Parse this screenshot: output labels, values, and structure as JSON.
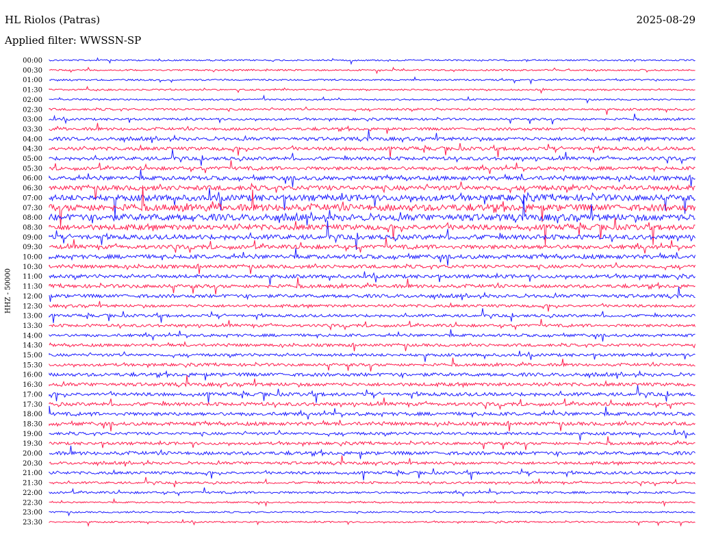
{
  "header": {
    "station": "HL Riolos (Patras)",
    "date": "2025-08-29",
    "filter": "Applied filter: WWSSN-SP"
  },
  "colors": {
    "even": "#1a1aff",
    "odd": "#ff1a4b",
    "text": "#000000",
    "background": "#ffffff"
  },
  "chart_data": {
    "type": "helicorder",
    "ylabel": "HHZ - 50000",
    "trace_colors": [
      "blue",
      "red"
    ],
    "tick_labels": [
      "00:00",
      "00:30",
      "01:00",
      "01:30",
      "02:00",
      "02:30",
      "03:00",
      "03:30",
      "04:00",
      "04:30",
      "05:00",
      "05:30",
      "06:00",
      "06:30",
      "07:00",
      "07:30",
      "08:00",
      "08:30",
      "09:00",
      "09:30",
      "10:00",
      "10:30",
      "11:00",
      "11:30",
      "12:00",
      "12:30",
      "13:00",
      "13:30",
      "14:00",
      "14:30",
      "15:00",
      "15:30",
      "16:00",
      "16:30",
      "17:00",
      "17:30",
      "18:00",
      "18:30",
      "19:00",
      "19:30",
      "20:00",
      "20:30",
      "21:00",
      "21:30",
      "22:00",
      "22:30",
      "23:00",
      "23:30"
    ],
    "noise_level": [
      1,
      1,
      1,
      1,
      1,
      2,
      2,
      3,
      4,
      4,
      4,
      4,
      5,
      6,
      8,
      9,
      9,
      7,
      6,
      5,
      5,
      4,
      4,
      4,
      4,
      3,
      3,
      3,
      3,
      3,
      3,
      3,
      4,
      4,
      4,
      4,
      4,
      4,
      3,
      3,
      4,
      3,
      3,
      2,
      2,
      1,
      1,
      1
    ]
  }
}
